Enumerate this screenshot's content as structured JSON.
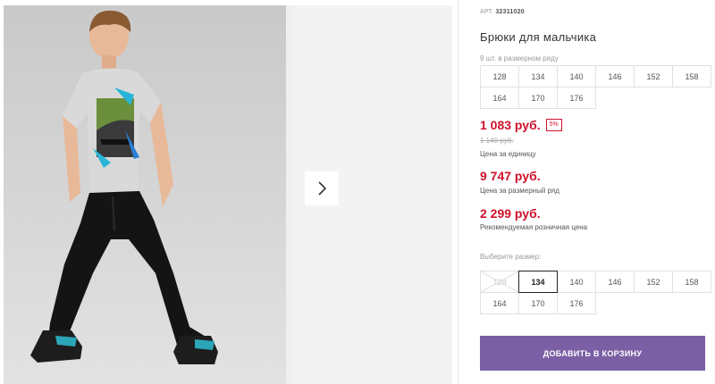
{
  "product": {
    "article_label": "АРТ.",
    "article_number": "32311020",
    "title": "Брюки для мальчика",
    "pieces_note": "9 шт. в размерном ряду"
  },
  "size_range": [
    "128",
    "134",
    "140",
    "146",
    "152",
    "158",
    "164",
    "170",
    "176"
  ],
  "prices": {
    "unit_price": "1 083 руб.",
    "discount": "5%",
    "old_price": "1 140 руб.",
    "unit_label": "Цена за единицу",
    "range_price": "9 747 руб.",
    "range_label": "Цена за размерный ряд",
    "retail_price": "2 299 руб.",
    "retail_label": "Рекомендуемая розничная цена"
  },
  "size_select": {
    "label": "Выберите размер:",
    "sizes": [
      {
        "size": "128",
        "state": "disabled"
      },
      {
        "size": "134",
        "state": "selected"
      },
      {
        "size": "140",
        "state": "available"
      },
      {
        "size": "146",
        "state": "available"
      },
      {
        "size": "152",
        "state": "available"
      },
      {
        "size": "158",
        "state": "available"
      },
      {
        "size": "164",
        "state": "available"
      },
      {
        "size": "170",
        "state": "available"
      },
      {
        "size": "176",
        "state": "available"
      }
    ]
  },
  "actions": {
    "add_to_cart": "ДОБАВИТЬ В КОРЗИНУ",
    "next_icon": "chevron-right-icon"
  },
  "colors": {
    "price_red": "#d0112b",
    "button_purple": "#7b5fa5"
  }
}
